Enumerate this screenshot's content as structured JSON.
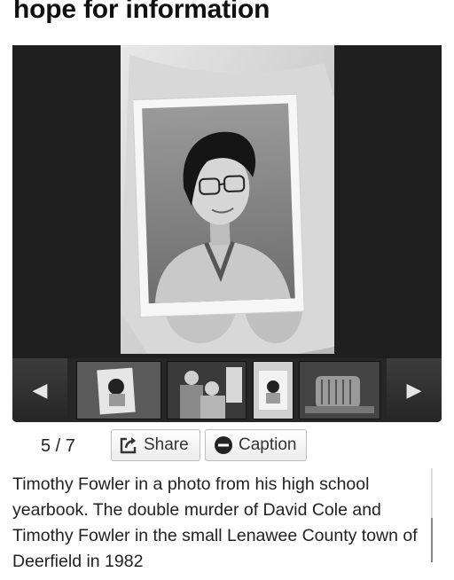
{
  "article": {
    "headline": "hope for information"
  },
  "gallery": {
    "counter": "5 / 7",
    "share_label": "Share",
    "caption_button_label": "Caption",
    "caption_text": "Timothy Fowler in a photo from his high school yearbook. The double murder of David Cole and Timothy Fowler in the small Lenawee County town of Deerfield in 1982",
    "prev_icon": "◀",
    "next_icon": "▶",
    "thumbnails": [
      "thumbnail-1",
      "thumbnail-2",
      "thumbnail-3",
      "thumbnail-4"
    ]
  }
}
